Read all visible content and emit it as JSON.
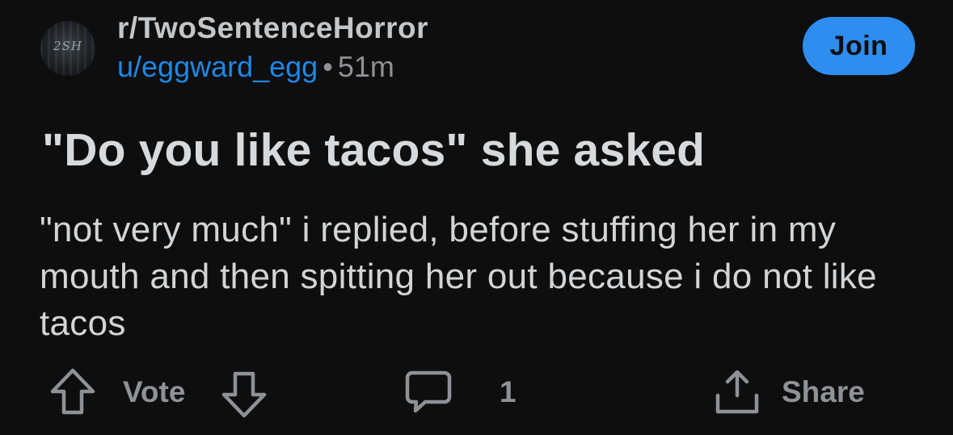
{
  "post": {
    "subreddit": "r/TwoSentenceHorror",
    "author": "u/eggward_egg",
    "separator": "•",
    "age": "51m",
    "join_label": "Join",
    "title": "\"Do you like tacos\" she asked",
    "body": "\"not very much\" i replied, before stuffing her in my mouth and then spitting her out because i do not like tacos"
  },
  "avatar": {
    "mark": "2SH"
  },
  "actions": {
    "vote_label": "Vote",
    "comment_count": "1",
    "share_label": "Share"
  },
  "icons": {
    "upvote": "arrow-up-icon",
    "downvote": "arrow-down-icon",
    "comment": "speech-bubble-icon",
    "share": "share-tray-icon"
  },
  "colors": {
    "background": "#0e0e0e",
    "join_button": "#2f8df0",
    "username": "#1e88e5",
    "muted": "#8e9296"
  }
}
